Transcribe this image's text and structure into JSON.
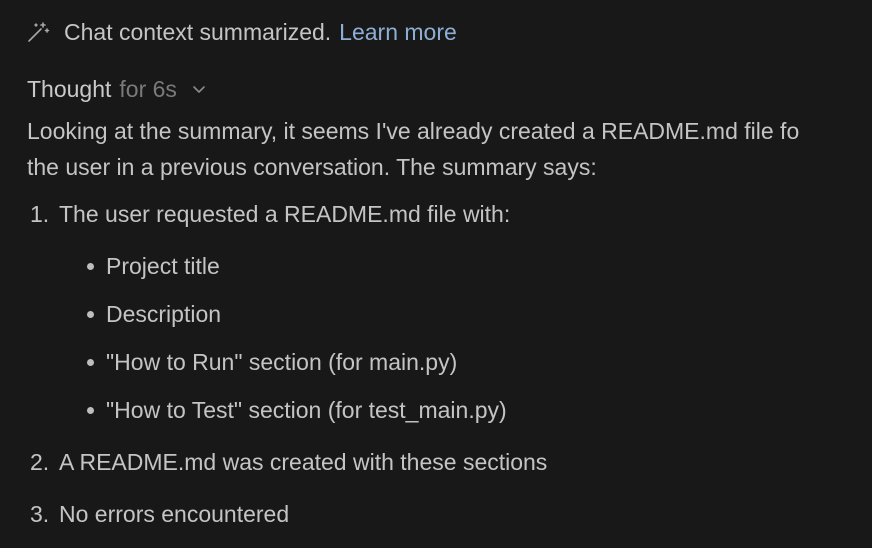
{
  "banner": {
    "icon": "magic-wand-icon",
    "text": "Chat context summarized.",
    "link": "Learn more"
  },
  "thought": {
    "label": "Thought",
    "duration": "for 6s",
    "toggle_icon": "chevron-down-icon"
  },
  "paragraph": {
    "line1": "Looking at the summary, it seems I've already created a README.md file fo",
    "line2": "the user in a previous conversation. The summary says:"
  },
  "list": {
    "items": [
      {
        "num": "1.",
        "text": "The user requested a README.md file with:"
      },
      {
        "num": "2.",
        "text": "A README.md was created with these sections"
      },
      {
        "num": "3.",
        "text": "No errors encountered"
      }
    ],
    "sub_items": [
      "Project title",
      "Description",
      "\"How to Run\" section (for main.py)",
      "\"How to Test\" section (for test_main.py)"
    ]
  },
  "colors": {
    "background": "#181818",
    "text": "#c4c4c4",
    "muted": "#7a7a7a",
    "link": "#8eaed4"
  }
}
